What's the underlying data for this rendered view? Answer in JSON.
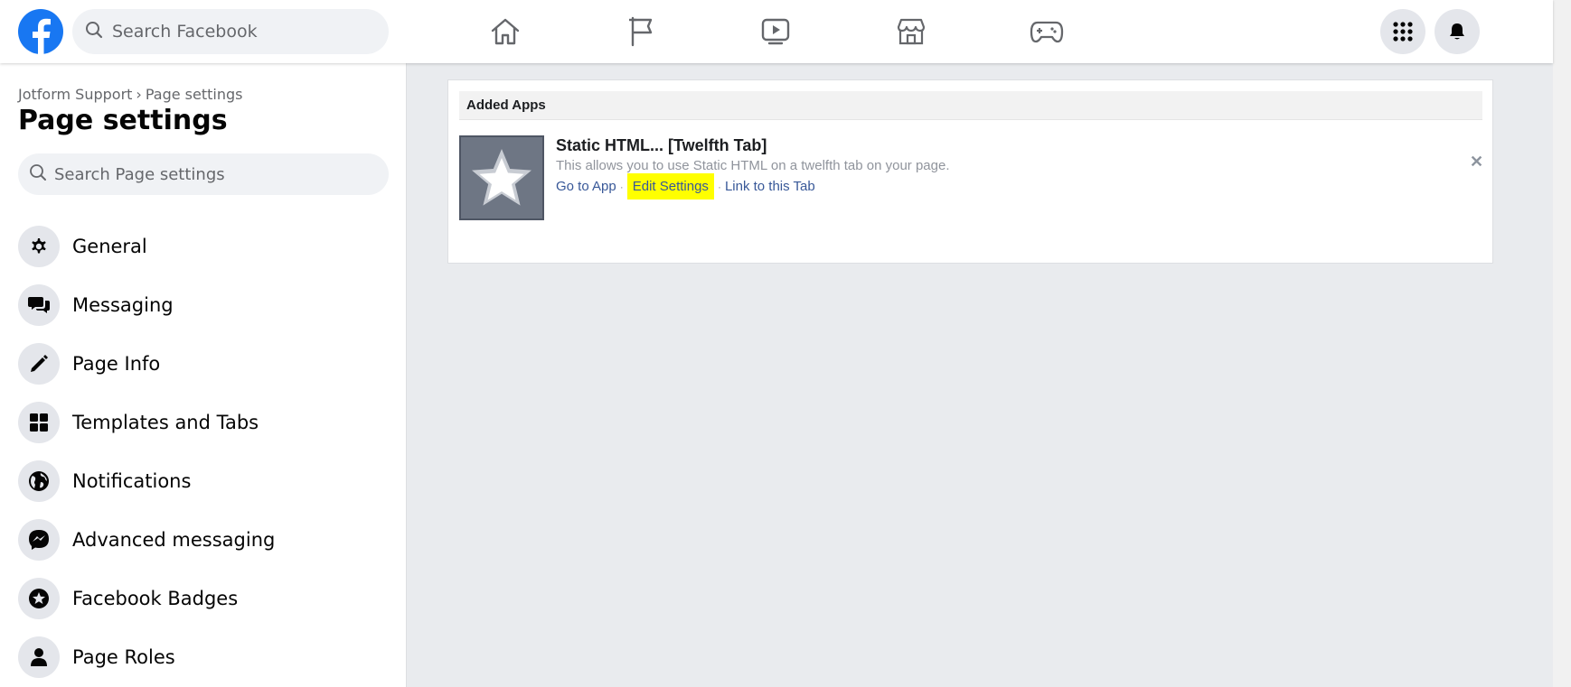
{
  "topbar": {
    "search_placeholder": "Search Facebook",
    "nav_icons": [
      "home-icon",
      "flag-icon",
      "video-icon",
      "marketplace-icon",
      "gaming-icon"
    ],
    "right_icons": [
      "menu-grid-icon",
      "notifications-bell-icon"
    ]
  },
  "sidebar": {
    "breadcrumb": {
      "parent": "Jotform Support",
      "separator": "›",
      "current": "Page settings"
    },
    "title": "Page settings",
    "search_placeholder": "Search Page settings",
    "items": [
      {
        "label": "General",
        "icon": "gear-icon"
      },
      {
        "label": "Messaging",
        "icon": "chat-bubbles-icon"
      },
      {
        "label": "Page Info",
        "icon": "pencil-icon"
      },
      {
        "label": "Templates and Tabs",
        "icon": "grid-tiles-icon"
      },
      {
        "label": "Notifications",
        "icon": "globe-icon"
      },
      {
        "label": "Advanced messaging",
        "icon": "messenger-icon"
      },
      {
        "label": "Facebook Badges",
        "icon": "badge-star-icon"
      },
      {
        "label": "Page Roles",
        "icon": "person-icon"
      }
    ]
  },
  "main": {
    "section_title": "Added Apps",
    "app": {
      "name": "Static HTML... [Twelfth Tab]",
      "description": "This allows you to use Static HTML on a twelfth tab on your page.",
      "links": {
        "go_to_app": "Go to App",
        "edit_settings": "Edit Settings",
        "link_to_tab": "Link to this Tab",
        "separator": "·"
      },
      "remove_glyph": "✕"
    }
  },
  "colors": {
    "brand_blue": "#1877f2",
    "link": "#385898",
    "highlight": "#ffff00",
    "page_bg": "#e9ebee"
  }
}
